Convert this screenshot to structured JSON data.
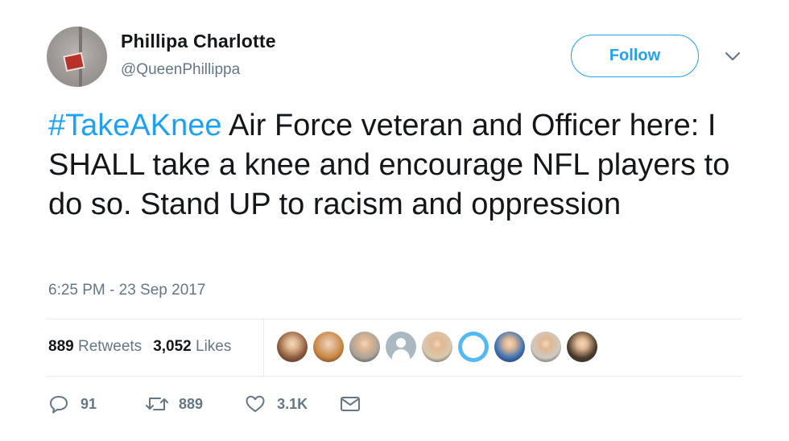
{
  "tweet": {
    "author_name": "Phillipa Charlotte",
    "author_handle": "@QueenPhillippa",
    "follow_label": "Follow",
    "hashtag": "#TakeAKnee",
    "body": " Air Force veteran and Officer here: I SHALL take a knee and encourage NFL players to do so. Stand UP to racism and oppression",
    "timestamp": "6:25 PM - 23 Sep 2017"
  },
  "stats": {
    "retweets_count": "889",
    "retweets_label": "Retweets",
    "likes_count": "3,052",
    "likes_label": "Likes"
  },
  "liker_avatars": [
    {
      "icon": "avatar-man-smiling",
      "color": "#8b5a3c"
    },
    {
      "icon": "avatar-woman-curly-hair",
      "color": "#c8843e"
    },
    {
      "icon": "avatar-man-glasses",
      "color": "#a9a29a"
    },
    {
      "icon": "avatar-default-egg",
      "color": "#aab8c2"
    },
    {
      "icon": "avatar-animal",
      "color": "#d9c9b0"
    },
    {
      "icon": "avatar-blue-ring",
      "color": "#55b8f0"
    },
    {
      "icon": "avatar-bernie-sign",
      "color": "#3a6fb5"
    },
    {
      "icon": "avatar-man-gray",
      "color": "#cfcac4"
    },
    {
      "icon": "avatar-man-dark",
      "color": "#4a3a2c"
    }
  ],
  "actions": {
    "reply_count": "91",
    "retweet_count": "889",
    "like_count": "3.1K"
  },
  "colors": {
    "accent": "#1da1f2",
    "secondary_text": "#657786",
    "primary_text": "#14171a",
    "divider": "#e6ecf0"
  }
}
